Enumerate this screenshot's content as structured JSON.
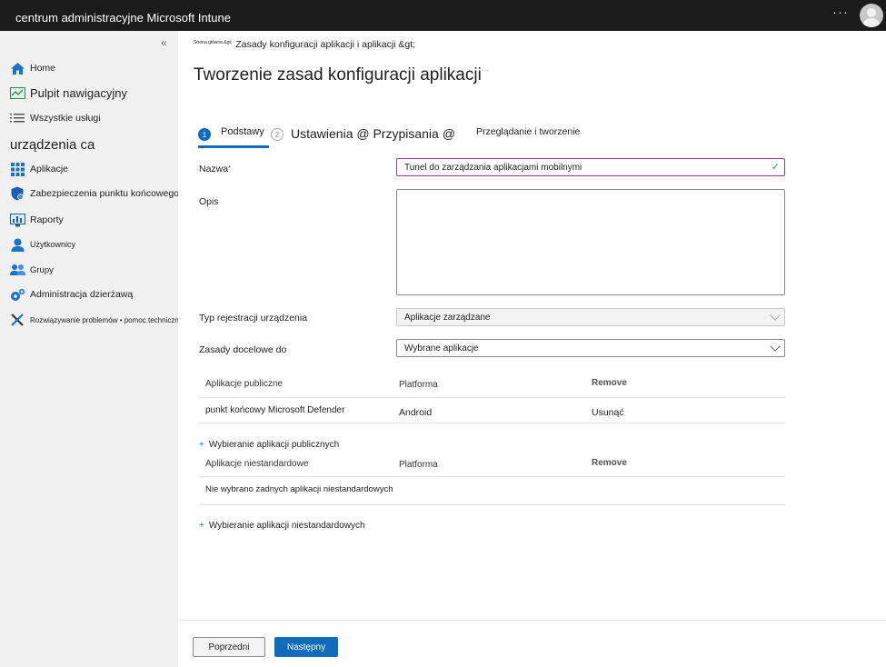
{
  "app": {
    "title": "centrum administracyjne Microsoft Intune",
    "more": "···"
  },
  "sidebar": {
    "collapse": "«",
    "section": "urządzenia ca",
    "items": [
      {
        "label": "Home"
      },
      {
        "label": "Pulpit nawigacyjny"
      },
      {
        "label": "Wszystkie usługi"
      },
      {
        "label": "Aplikacje"
      },
      {
        "label": "Zabezpieczenia punktu końcowego"
      },
      {
        "label": "Raporty"
      },
      {
        "label": "Użytkownicy"
      },
      {
        "label": "Grupy"
      },
      {
        "label": "Administracja dzierżawą"
      },
      {
        "label": "Rozwiązywanie problemów • pomoc techniczna"
      }
    ]
  },
  "breadcrumb": {
    "home": "Strona główna &gt;",
    "path": "Zasady konfiguracji aplikacji i aplikacji &gt;"
  },
  "page": {
    "title": "Tworzenie zasad konfiguracji aplikacji",
    "title_suffix": "···"
  },
  "steps": [
    {
      "num": "1",
      "label": "Podstawy"
    },
    {
      "num": "2",
      "label": "Ustawienia @ Przypisania @"
    },
    {
      "num": "",
      "label": "Przeglądanie i tworzenie"
    }
  ],
  "form": {
    "name_label": "Nazwa",
    "name_required": "*",
    "name_value": "Tunel do zarządzania aplikacjami mobilnymi",
    "desc_label": "Opis",
    "desc_value": "",
    "type_label": "Typ rejestracji urządzenia",
    "type_value": "Aplikacje zarządzane",
    "target_label": "Zasady docelowe do",
    "target_value": "Wybrane aplikacje"
  },
  "public_apps": {
    "columns": [
      "Aplikacje publiczne",
      "Platforma",
      "Remove"
    ],
    "rows": [
      {
        "name": "punkt końcowy Microsoft Defender",
        "platform": "Android",
        "action": "Usunąć"
      }
    ],
    "add_link": "Wybieranie aplikacji publicznych"
  },
  "custom_apps": {
    "columns": [
      "Aplikacje niestandardowe",
      "Platforma",
      "Remove"
    ],
    "empty": "Nie wybrano żadnych aplikacji niestandardowych",
    "add_link": "Wybieranie aplikacji niestandardowych"
  },
  "footer": {
    "prev": "Poprzedni",
    "next": "Następny"
  },
  "colors": {
    "accent": "#0f6cbd",
    "topbar": "#1b1b1b",
    "sidebar": "#f1f1f1"
  }
}
